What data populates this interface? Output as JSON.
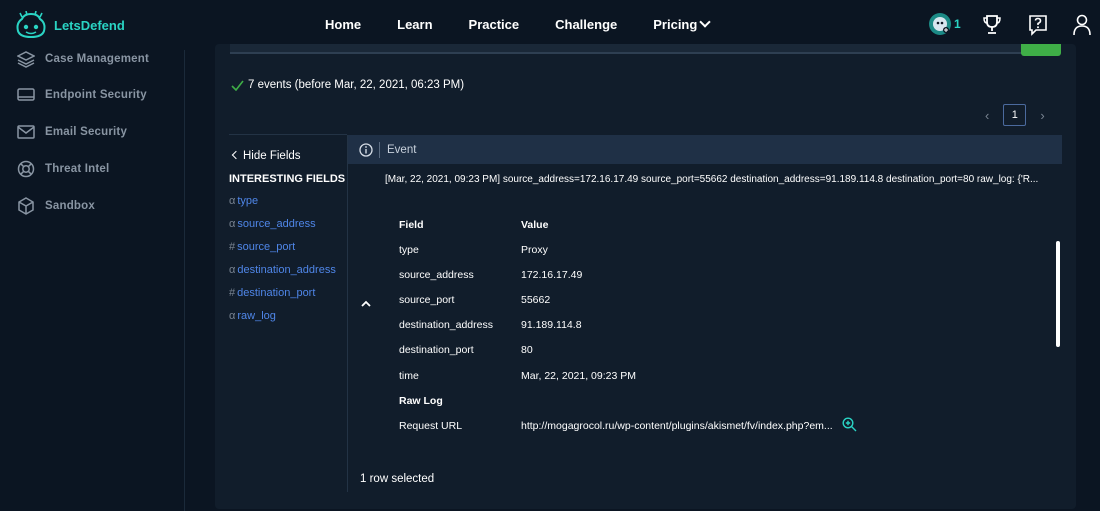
{
  "brand": {
    "name": "LetsDefend",
    "accent": "#2ad4c4"
  },
  "nav": {
    "items": [
      {
        "label": "Home"
      },
      {
        "label": "Learn"
      },
      {
        "label": "Practice"
      },
      {
        "label": "Challenge"
      },
      {
        "label": "Pricing"
      }
    ]
  },
  "header_right": {
    "badge_count": "1",
    "icons": [
      "badge-icon",
      "trophy-icon",
      "help-icon",
      "user-icon"
    ]
  },
  "sidebar": {
    "items": [
      {
        "label": "Case Management",
        "icon": "layers-icon"
      },
      {
        "label": "Endpoint Security",
        "icon": "endpoint-icon"
      },
      {
        "label": "Email Security",
        "icon": "mail-icon"
      },
      {
        "label": "Threat Intel",
        "icon": "lifebuoy-icon"
      },
      {
        "label": "Sandbox",
        "icon": "cube-icon"
      }
    ]
  },
  "summary": {
    "text": "7 events (before Mar, 22, 2021, 06:23 PM)"
  },
  "pager": {
    "current": "1"
  },
  "fields": {
    "hide_label": "Hide Fields",
    "heading": "INTERESTING FIELDS",
    "items": [
      {
        "prefix": "α",
        "name": "type"
      },
      {
        "prefix": "α",
        "name": "source_address"
      },
      {
        "prefix": "#",
        "name": "source_port"
      },
      {
        "prefix": "α",
        "name": "destination_address"
      },
      {
        "prefix": "#",
        "name": "destination_port"
      },
      {
        "prefix": "α",
        "name": "raw_log"
      }
    ]
  },
  "event": {
    "header": "Event",
    "raw": "[Mar, 22, 2021, 09:23 PM] source_address=172.16.17.49 source_port=55662 destination_address=91.189.114.8 destination_port=80 raw_log: {'R...",
    "table_headers": {
      "field": "Field",
      "value": "Value"
    },
    "rows": [
      {
        "field": "type",
        "value": "Proxy"
      },
      {
        "field": "source_address",
        "value": "172.16.17.49"
      },
      {
        "field": "source_port",
        "value": "55662"
      },
      {
        "field": "destination_address",
        "value": "91.189.114.8"
      },
      {
        "field": "destination_port",
        "value": "80"
      },
      {
        "field": "time",
        "value": "Mar, 22, 2021, 09:23 PM"
      },
      {
        "field": "Raw Log",
        "value": ""
      },
      {
        "field": "Request URL",
        "value": "http://mogagrocol.ru/wp-content/plugins/akismet/fv/index.php?em..."
      }
    ]
  },
  "footer": {
    "selected": "1 row selected"
  }
}
